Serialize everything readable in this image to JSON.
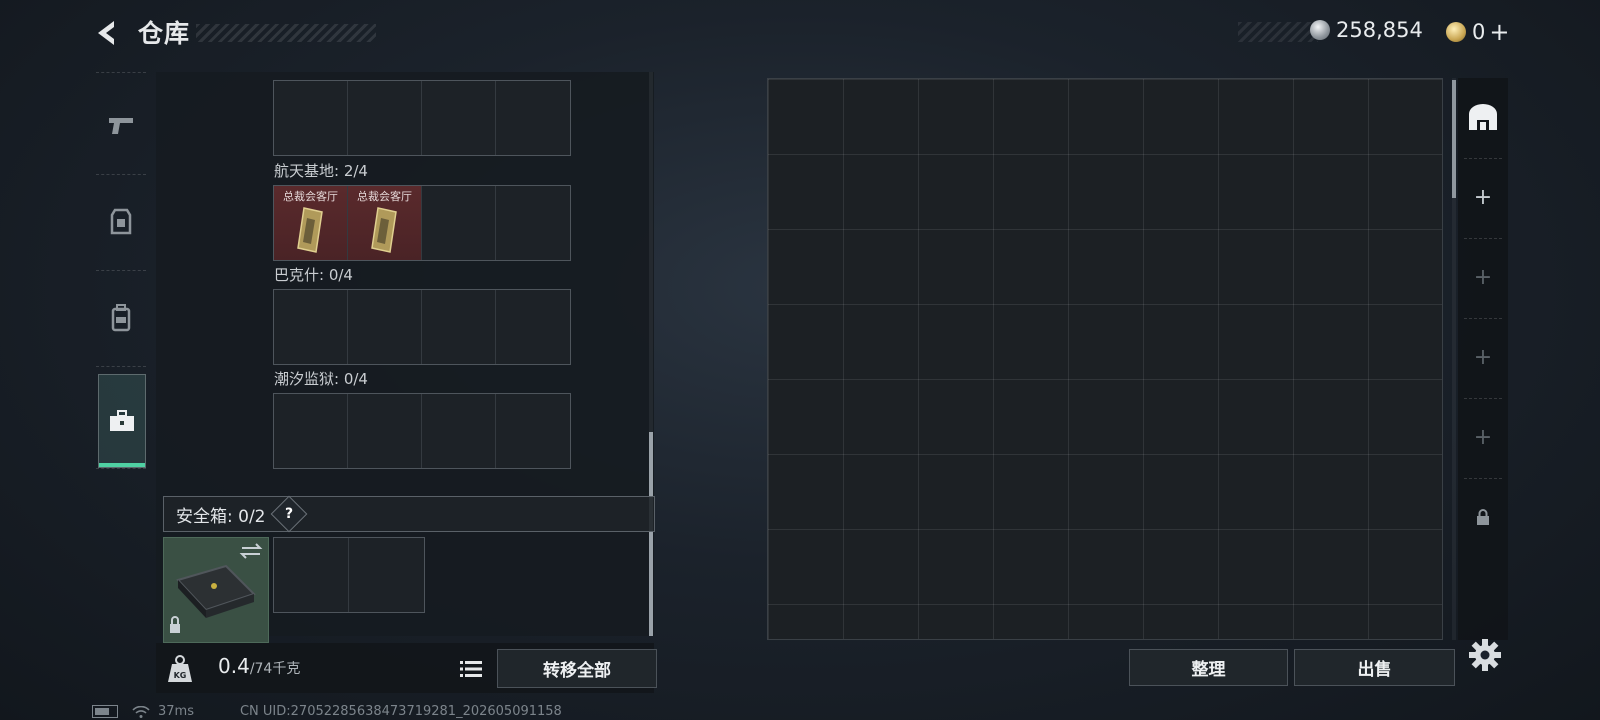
{
  "header": {
    "title": "仓库",
    "currencies": [
      {
        "icon": "silver-coin-icon",
        "value": "258,854"
      },
      {
        "icon": "gold-coin-icon",
        "value": "0"
      }
    ],
    "add_label": "+"
  },
  "side_tabs": [
    {
      "icon": "pistol-icon",
      "active": false
    },
    {
      "icon": "armor-vest-icon",
      "active": false
    },
    {
      "icon": "backpack-icon",
      "active": false
    },
    {
      "icon": "toolbox-icon",
      "active": true
    }
  ],
  "key_sections": [
    {
      "label": "",
      "slots": [
        null,
        null,
        null,
        null
      ]
    },
    {
      "label": "航天基地: 2/4",
      "slots": [
        "总裁会客厅",
        "总裁会客厅",
        null,
        null
      ]
    },
    {
      "label": "巴克什: 0/4",
      "slots": [
        null,
        null,
        null,
        null
      ]
    },
    {
      "label": "潮汐监狱: 0/4",
      "slots": [
        null,
        null,
        null,
        null
      ]
    }
  ],
  "safebox": {
    "label": "安全箱:  0/2",
    "help": "?",
    "swap_icon": "swap-icon",
    "lock_icon": "lock-icon"
  },
  "weight": {
    "current": "0.4",
    "max": "/74千克"
  },
  "buttons": {
    "transfer_all": "转移全部",
    "sort": "整理",
    "sell": "出售"
  },
  "stash_tabs": [
    {
      "icon": "stash-home-icon"
    },
    {
      "icon": "plus-icon",
      "label": "+"
    },
    {
      "icon": "plus-icon",
      "label": "+"
    },
    {
      "icon": "plus-icon",
      "label": "+"
    },
    {
      "icon": "plus-icon",
      "label": "+"
    },
    {
      "icon": "lock-icon"
    }
  ],
  "status": {
    "ping": "37ms",
    "uid": "CN UID:27052285638473719281_202605091158"
  },
  "colors": {
    "accent": "#4fd1a3",
    "key_slot": "#5a2a2c"
  }
}
